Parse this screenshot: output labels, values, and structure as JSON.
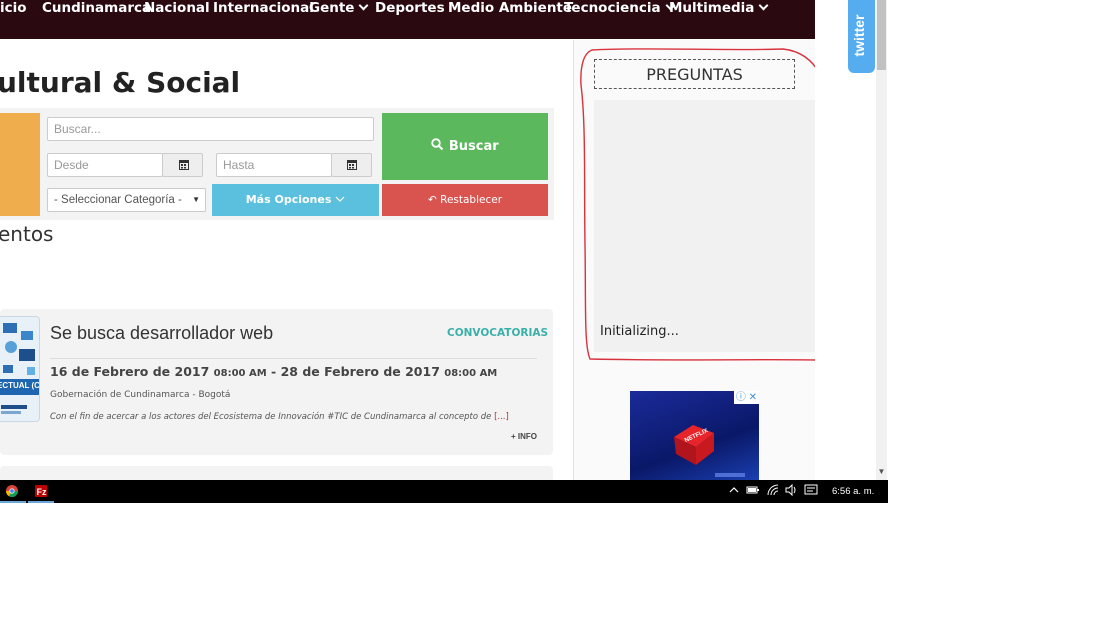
{
  "nav": {
    "items": [
      {
        "label": "icio",
        "dropdown": false
      },
      {
        "label": "Cundinamarca",
        "dropdown": false
      },
      {
        "label": "Nacional",
        "dropdown": false
      },
      {
        "label": "Internacional",
        "dropdown": false
      },
      {
        "label": "Gente",
        "dropdown": true
      },
      {
        "label": "Deportes",
        "dropdown": false
      },
      {
        "label": "Medio Ambiente",
        "dropdown": false
      },
      {
        "label": "Tecnociencia",
        "dropdown": true
      },
      {
        "label": "Multimedia",
        "dropdown": true
      }
    ],
    "bg_color": "#2a0a10"
  },
  "main": {
    "heading": "ultural & Social",
    "section_heading": "entos"
  },
  "search": {
    "placeholder": "Buscar...",
    "from_placeholder": "Desde",
    "to_placeholder": "Hasta",
    "category_selected": "- Seleccionar Categoría -",
    "search_button": "Buscar",
    "more_options_button": "Más Opciones",
    "reset_button": "Restablecer",
    "colors": {
      "search": "#5cb85c",
      "more_options": "#5bc0de",
      "reset": "#d9534f",
      "accent": "#f0ad4e"
    }
  },
  "event": {
    "title": "Se busca desarrollador web",
    "category": "CONVOCATORIAS",
    "start_date": "16 de Febrero de 2017",
    "start_time": "08:00 AM",
    "date_separator": "-",
    "end_date": "28 de Febrero de 2017",
    "end_time": "08:00 AM",
    "location": "Gobernación de Cundinamarca - Bogotá",
    "excerpt": "Con el fin de acercar a los actores del Ecosistema de Innovación #TIC de Cundinamarca al concepto de",
    "excerpt_more": "[...]",
    "more_info": "+ INFO",
    "thumb_text": "ECTUAL (CV"
  },
  "sidebar": {
    "widget_title": "PREGUNTAS",
    "status": "Initializing...",
    "ad_brand": "NETFLIX",
    "ad_badge": "ⓘ ✕"
  },
  "twitter": {
    "label": "twitter"
  },
  "taskbar": {
    "time": "6:56 a. m.",
    "apps": [
      {
        "icon": "chrome-icon"
      },
      {
        "icon": "filezilla-icon"
      }
    ],
    "tray_icons": [
      "chevron-up-icon",
      "battery-icon",
      "wifi-icon",
      "volume-icon",
      "notifications-icon"
    ]
  }
}
